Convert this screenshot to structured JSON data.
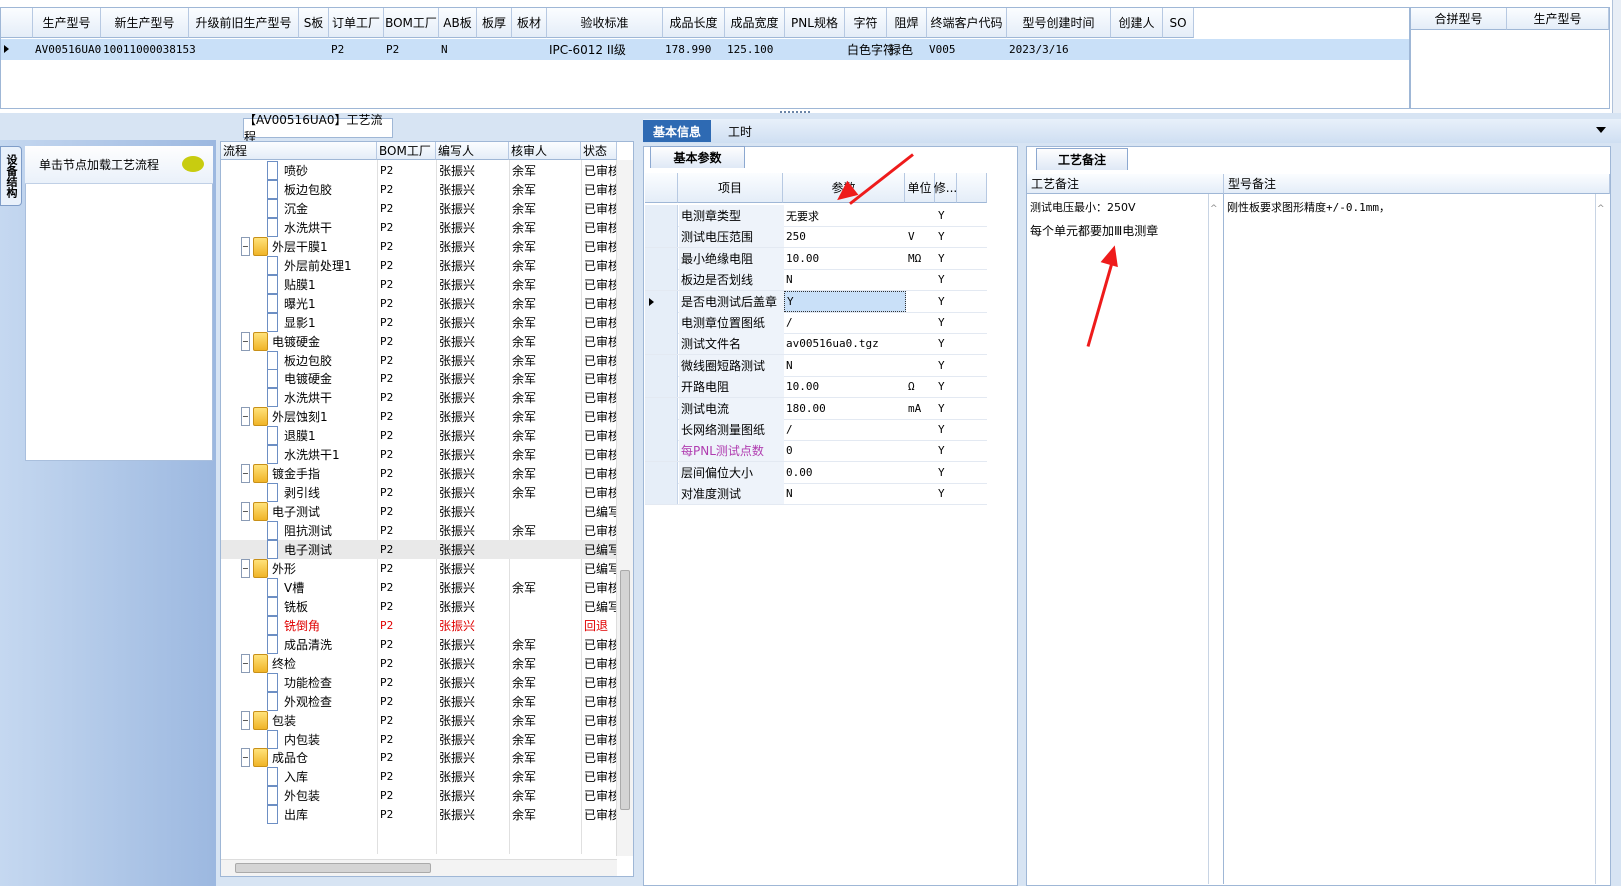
{
  "top_grid": {
    "headers": [
      "生产型号",
      "新生产型号",
      "升级前旧生产型号",
      "S板",
      "订单工厂",
      "BOM工厂",
      "AB板",
      "板厚",
      "板材",
      "验收标准",
      "成品长度",
      "成品宽度",
      "PNL规格",
      "字符",
      "阻焊",
      "终端客户代码",
      "型号创建时间",
      "创建人",
      "SO"
    ],
    "row": [
      "AV00516UA0",
      "10011000038153",
      "",
      "",
      "P2",
      "P2",
      "N",
      "",
      "",
      "IPC-6012 II级",
      "178.990",
      "125.100",
      "",
      "白色字符",
      "绿色",
      "V005",
      "2023/3/16",
      "",
      ""
    ]
  },
  "side_grid": {
    "headers": [
      "合拼型号",
      "生产型号"
    ]
  },
  "left_panel": {
    "vtab": "设备结构",
    "load_hint": "单击节点加载工艺流程"
  },
  "flow_title": "【AV00516UA0】工艺流程",
  "tree": {
    "headers": [
      "流程",
      "BOM工厂",
      "编写人",
      "核审人",
      "状态"
    ],
    "rows": [
      {
        "name": "喷砂",
        "type": "doc",
        "bom": "P2",
        "writer": "张振兴",
        "reviewer": "余军",
        "status": "已审核"
      },
      {
        "name": "板边包胶",
        "type": "doc",
        "bom": "P2",
        "writer": "张振兴",
        "reviewer": "余军",
        "status": "已审核"
      },
      {
        "name": "沉金",
        "type": "doc",
        "bom": "P2",
        "writer": "张振兴",
        "reviewer": "余军",
        "status": "已审核"
      },
      {
        "name": "水洗烘干",
        "type": "doc",
        "bom": "P2",
        "writer": "张振兴",
        "reviewer": "余军",
        "status": "已审核"
      },
      {
        "name": "外层干膜1",
        "type": "folder",
        "bom": "P2",
        "writer": "张振兴",
        "reviewer": "余军",
        "status": "已审核"
      },
      {
        "name": "外层前处理1",
        "type": "doc",
        "bom": "P2",
        "writer": "张振兴",
        "reviewer": "余军",
        "status": "已审核"
      },
      {
        "name": "贴膜1",
        "type": "doc",
        "bom": "P2",
        "writer": "张振兴",
        "reviewer": "余军",
        "status": "已审核"
      },
      {
        "name": "曝光1",
        "type": "doc",
        "bom": "P2",
        "writer": "张振兴",
        "reviewer": "余军",
        "status": "已审核"
      },
      {
        "name": "显影1",
        "type": "doc",
        "bom": "P2",
        "writer": "张振兴",
        "reviewer": "余军",
        "status": "已审核"
      },
      {
        "name": "电镀硬金",
        "type": "folder",
        "bom": "P2",
        "writer": "张振兴",
        "reviewer": "余军",
        "status": "已审核"
      },
      {
        "name": "板边包胶",
        "type": "doc",
        "bom": "P2",
        "writer": "张振兴",
        "reviewer": "余军",
        "status": "已审核"
      },
      {
        "name": "电镀硬金",
        "type": "doc",
        "bom": "P2",
        "writer": "张振兴",
        "reviewer": "余军",
        "status": "已审核"
      },
      {
        "name": "水洗烘干",
        "type": "doc",
        "bom": "P2",
        "writer": "张振兴",
        "reviewer": "余军",
        "status": "已审核"
      },
      {
        "name": "外层蚀刻1",
        "type": "folder",
        "bom": "P2",
        "writer": "张振兴",
        "reviewer": "余军",
        "status": "已审核"
      },
      {
        "name": "退膜1",
        "type": "doc",
        "bom": "P2",
        "writer": "张振兴",
        "reviewer": "余军",
        "status": "已审核"
      },
      {
        "name": "水洗烘干1",
        "type": "doc",
        "bom": "P2",
        "writer": "张振兴",
        "reviewer": "余军",
        "status": "已审核"
      },
      {
        "name": "镀金手指",
        "type": "folder",
        "bom": "P2",
        "writer": "张振兴",
        "reviewer": "余军",
        "status": "已审核"
      },
      {
        "name": "剥引线",
        "type": "doc",
        "bom": "P2",
        "writer": "张振兴",
        "reviewer": "余军",
        "status": "已审核"
      },
      {
        "name": "电子测试",
        "type": "folder",
        "bom": "P2",
        "writer": "张振兴",
        "reviewer": "",
        "status": "已编写"
      },
      {
        "name": "阻抗测试",
        "type": "doc",
        "bom": "P2",
        "writer": "张振兴",
        "reviewer": "余军",
        "status": "已审核"
      },
      {
        "name": "电子测试",
        "type": "doc",
        "bom": "P2",
        "writer": "张振兴",
        "reviewer": "",
        "status": "已编写",
        "selected": true
      },
      {
        "name": "外形",
        "type": "folder",
        "bom": "P2",
        "writer": "张振兴",
        "reviewer": "",
        "status": "已编写"
      },
      {
        "name": "V槽",
        "type": "doc",
        "bom": "P2",
        "writer": "张振兴",
        "reviewer": "余军",
        "status": "已审核"
      },
      {
        "name": "铣板",
        "type": "doc",
        "bom": "P2",
        "writer": "张振兴",
        "reviewer": "",
        "status": "已编写"
      },
      {
        "name": "铣倒角",
        "type": "doc",
        "bom": "P2",
        "writer": "张振兴",
        "reviewer": "",
        "status": "回退",
        "red": true
      },
      {
        "name": "成品清洗",
        "type": "doc",
        "bom": "P2",
        "writer": "张振兴",
        "reviewer": "余军",
        "status": "已审核"
      },
      {
        "name": "终检",
        "type": "folder",
        "bom": "P2",
        "writer": "张振兴",
        "reviewer": "余军",
        "status": "已审核"
      },
      {
        "name": "功能检查",
        "type": "doc",
        "bom": "P2",
        "writer": "张振兴",
        "reviewer": "余军",
        "status": "已审核"
      },
      {
        "name": "外观检查",
        "type": "doc",
        "bom": "P2",
        "writer": "张振兴",
        "reviewer": "余军",
        "status": "已审核"
      },
      {
        "name": "包装",
        "type": "folder",
        "bom": "P2",
        "writer": "张振兴",
        "reviewer": "余军",
        "status": "已审核"
      },
      {
        "name": "内包装",
        "type": "doc",
        "bom": "P2",
        "writer": "张振兴",
        "reviewer": "余军",
        "status": "已审核"
      },
      {
        "name": "成品仓",
        "type": "folder",
        "bom": "P2",
        "writer": "张振兴",
        "reviewer": "余军",
        "status": "已审核"
      },
      {
        "name": "入库",
        "type": "doc",
        "bom": "P2",
        "writer": "张振兴",
        "reviewer": "余军",
        "status": "已审核"
      },
      {
        "name": "外包装",
        "type": "doc",
        "bom": "P2",
        "writer": "张振兴",
        "reviewer": "余军",
        "status": "已审核"
      },
      {
        "name": "出库",
        "type": "doc",
        "bom": "P2",
        "writer": "张振兴",
        "reviewer": "余军",
        "status": "已审核"
      }
    ]
  },
  "mid_tabs": {
    "basic": "基本信息",
    "hours": "工时"
  },
  "basic_params": {
    "subtab": "基本参数",
    "headers": [
      "项目",
      "参数",
      "单位",
      "修..."
    ],
    "rows": [
      {
        "item": "电测章类型",
        "value": "无要求",
        "unit": "",
        "flag": "Y"
      },
      {
        "item": "测试电压范围",
        "value": "250",
        "unit": "V",
        "flag": "Y"
      },
      {
        "item": "最小绝缘电阻",
        "value": "10.00",
        "unit": "MΩ",
        "flag": "Y"
      },
      {
        "item": "板边是否划线",
        "value": "N",
        "unit": "",
        "flag": "Y"
      },
      {
        "item": "是否电测试后盖章",
        "value": "Y",
        "unit": "",
        "flag": "Y",
        "current": true
      },
      {
        "item": "电测章位置图纸",
        "value": "/",
        "unit": "",
        "flag": "Y"
      },
      {
        "item": "测试文件名",
        "value": "av00516ua0.tgz",
        "unit": "",
        "flag": "Y"
      },
      {
        "item": "微线圈短路测试",
        "value": "N",
        "unit": "",
        "flag": "Y"
      },
      {
        "item": "开路电阻",
        "value": "10.00",
        "unit": "Ω",
        "flag": "Y"
      },
      {
        "item": "测试电流",
        "value": "180.00",
        "unit": "mA",
        "flag": "Y"
      },
      {
        "item": "长网络测量图纸",
        "value": "/",
        "unit": "",
        "flag": "Y"
      },
      {
        "item": "每PNL测试点数",
        "value": "0",
        "unit": "",
        "flag": "Y",
        "purple": true
      },
      {
        "item": "层间偏位大小",
        "value": "0.00",
        "unit": "",
        "flag": "Y"
      },
      {
        "item": "对准度测试",
        "value": "N",
        "unit": "",
        "flag": "Y"
      }
    ]
  },
  "process_notes": {
    "subtab": "工艺备注",
    "headers": [
      "工艺备注",
      "型号备注"
    ],
    "process_note_lines": [
      "测试电压最小：250V",
      "每个单元都要加Ⅲ电测章"
    ],
    "model_note": "刚性板要求图形精度+/-0.1mm，"
  }
}
